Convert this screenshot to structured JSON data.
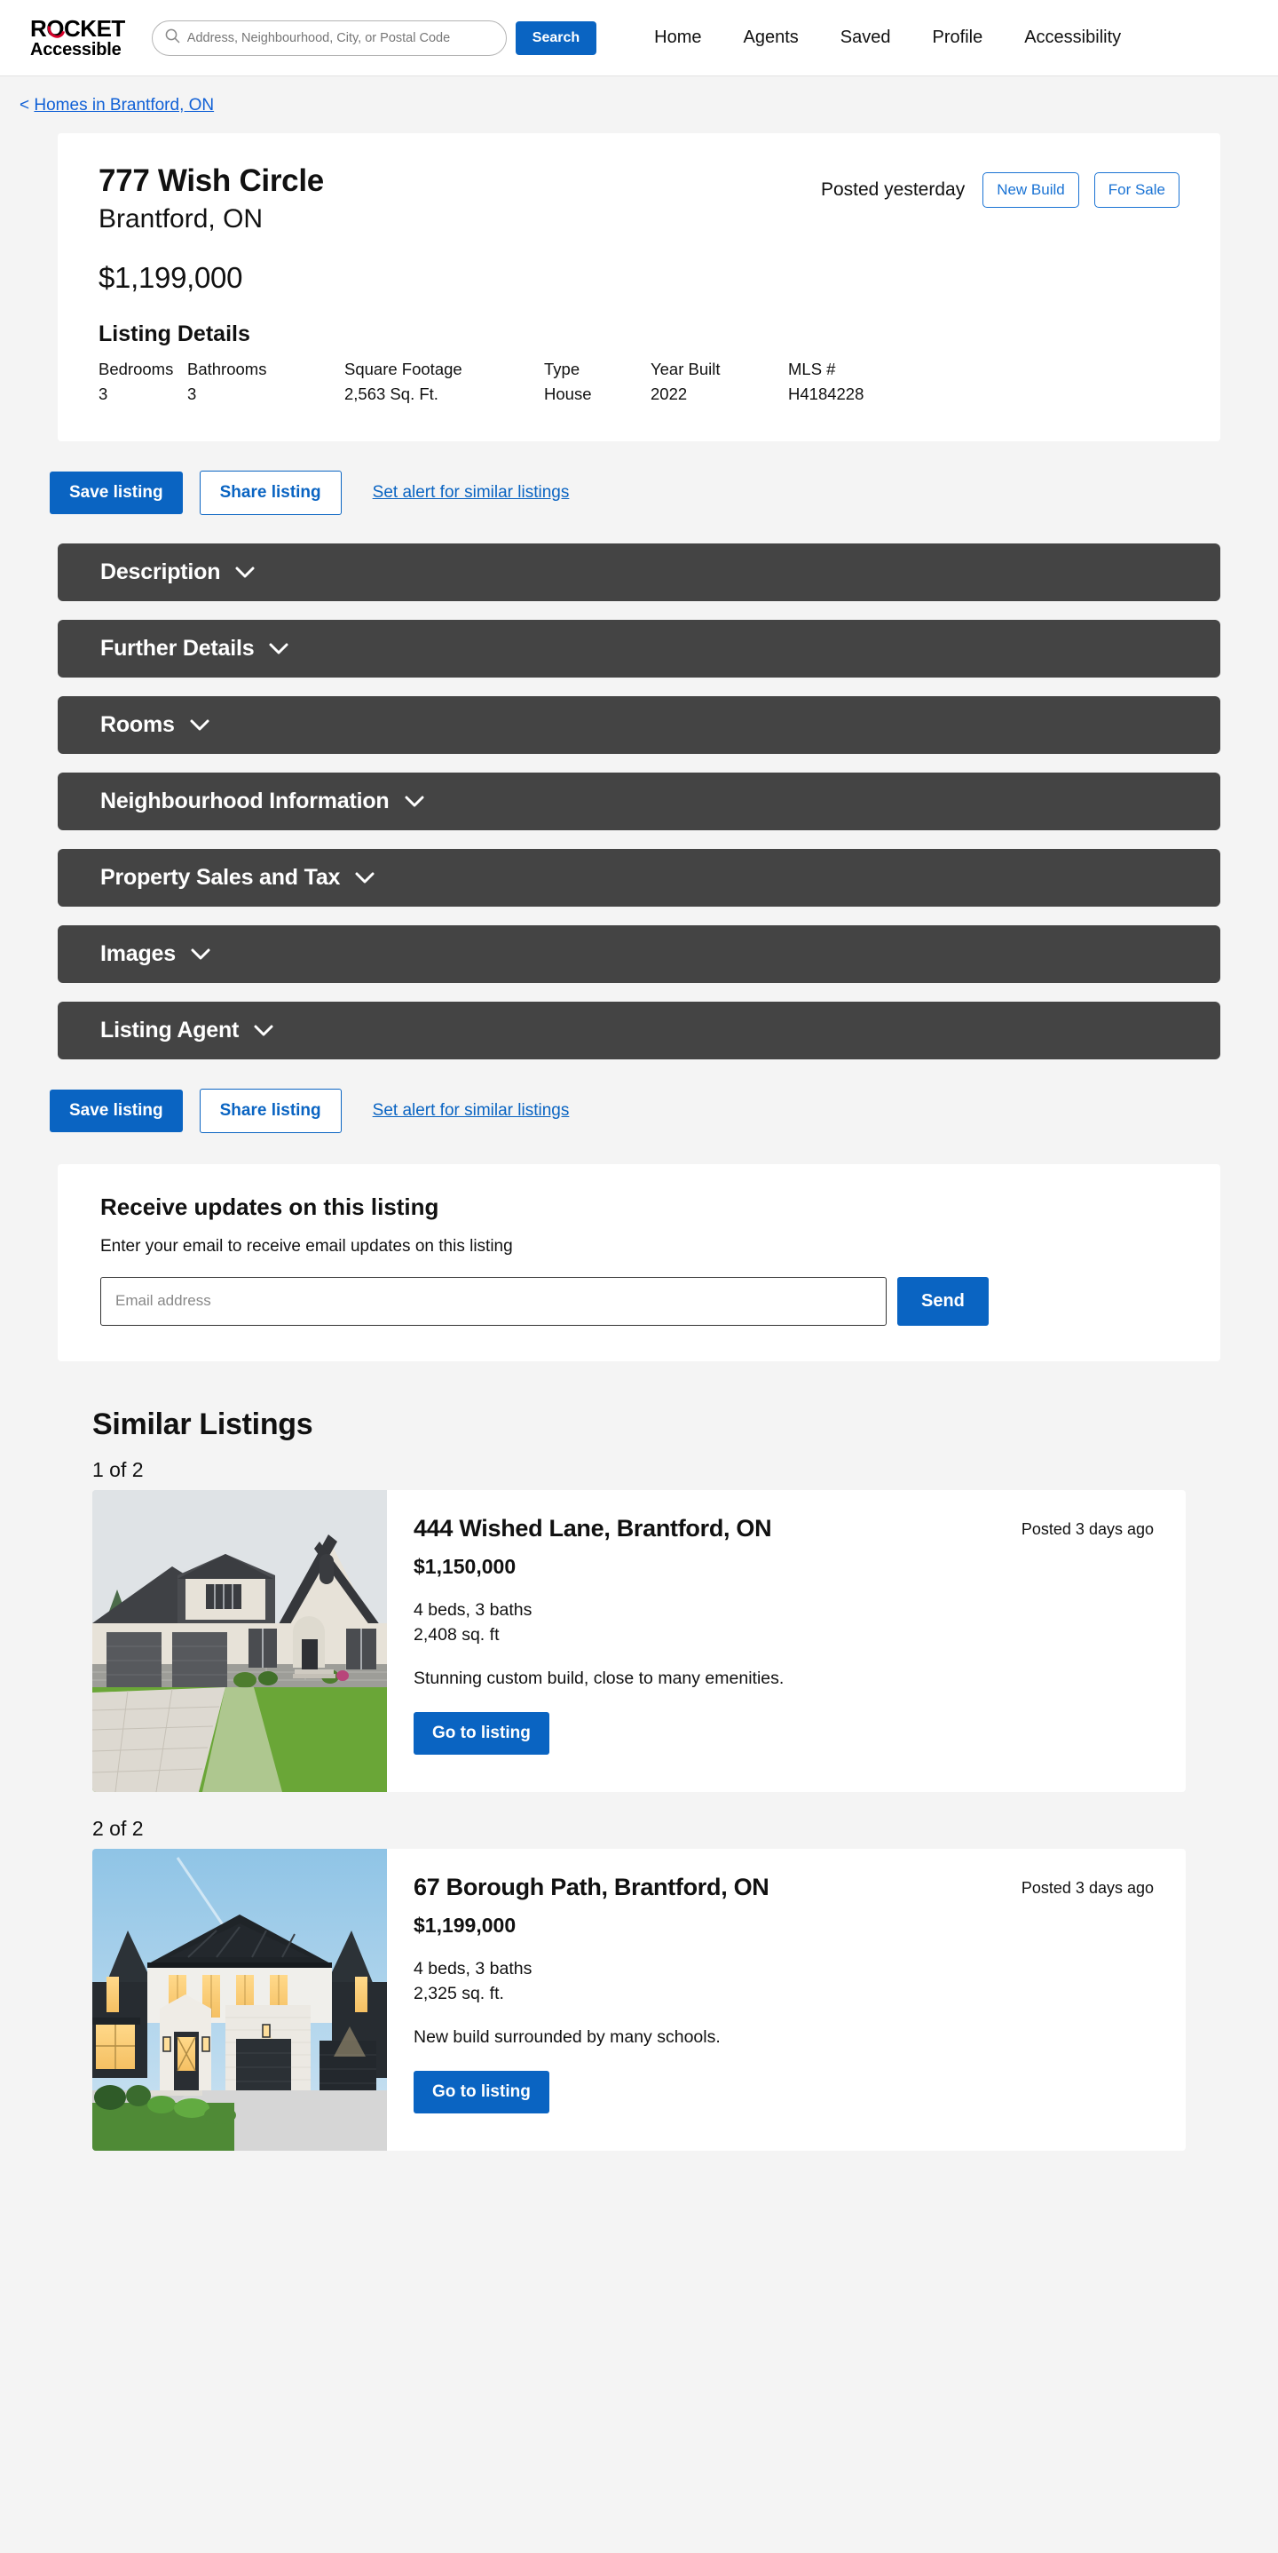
{
  "header": {
    "logo_top": "ROCKET",
    "logo_bottom": "Accessible",
    "search_placeholder": "Address, Neighbourhood, City, or Postal Code",
    "search_value": "",
    "search_button": "Search",
    "nav": [
      {
        "label": "Home"
      },
      {
        "label": "Agents"
      },
      {
        "label": "Saved"
      },
      {
        "label": "Profile"
      },
      {
        "label": "Accessibility"
      }
    ]
  },
  "breadcrumb": {
    "prefix": "<",
    "label": "Homes in Brantford, ON"
  },
  "listing": {
    "address": "777 Wish Circle",
    "city": "Brantford, ON",
    "posted": "Posted yesterday",
    "badges": [
      "New Build",
      "For Sale"
    ],
    "price": "$1,199,000",
    "details_title": "Listing Details",
    "details": [
      {
        "key": "Bedrooms",
        "value": "3"
      },
      {
        "key": "Bathrooms",
        "value": "3"
      },
      {
        "key": "Square Footage",
        "value": "2,563 Sq. Ft."
      },
      {
        "key": "Type",
        "value": "House"
      },
      {
        "key": "Year Built",
        "value": "2022"
      },
      {
        "key": "MLS #",
        "value": "H4184228"
      }
    ]
  },
  "actions": {
    "save": "Save listing",
    "share": "Share listing",
    "alert": "Set alert for similar listings"
  },
  "accordions": [
    {
      "label": "Description"
    },
    {
      "label": "Further Details"
    },
    {
      "label": "Rooms"
    },
    {
      "label": "Neighbourhood Information"
    },
    {
      "label": "Property Sales and Tax"
    },
    {
      "label": "Images"
    },
    {
      "label": "Listing Agent"
    }
  ],
  "email_updates": {
    "title": "Receive updates on this listing",
    "subtitle": "Enter your email to receive email updates on this listing",
    "placeholder": "Email address",
    "value": "",
    "send_label": "Send"
  },
  "similar": {
    "title": "Similar Listings",
    "items": [
      {
        "counter": "1 of 2",
        "address": "444 Wished Lane, Brantford, ON",
        "posted": "Posted 3 days ago",
        "price": "$1,150,000",
        "beds_baths": "4 beds, 3 baths",
        "sqft": "2,408 sq. ft",
        "description": "Stunning custom build, close to many emenities.",
        "cta": "Go to listing",
        "image_alt": "two-storey-stucco-house-photo"
      },
      {
        "counter": "2 of 2",
        "address": "67 Borough Path, Brantford, ON",
        "posted": "Posted 3 days ago",
        "price": "$1,199,000",
        "beds_baths": "4 beds, 3 baths",
        "sqft": "2,325 sq. ft.",
        "description": "New build surrounded by many schools.",
        "cta": "Go to listing",
        "image_alt": "modern-dark-farmhouse-render"
      }
    ]
  },
  "colors": {
    "accent_blue": "#0a64c2",
    "link_blue": "#1060d6",
    "accordion_bg": "#444444",
    "page_bg": "#f4f4f4",
    "logo_red": "#d6002a"
  }
}
